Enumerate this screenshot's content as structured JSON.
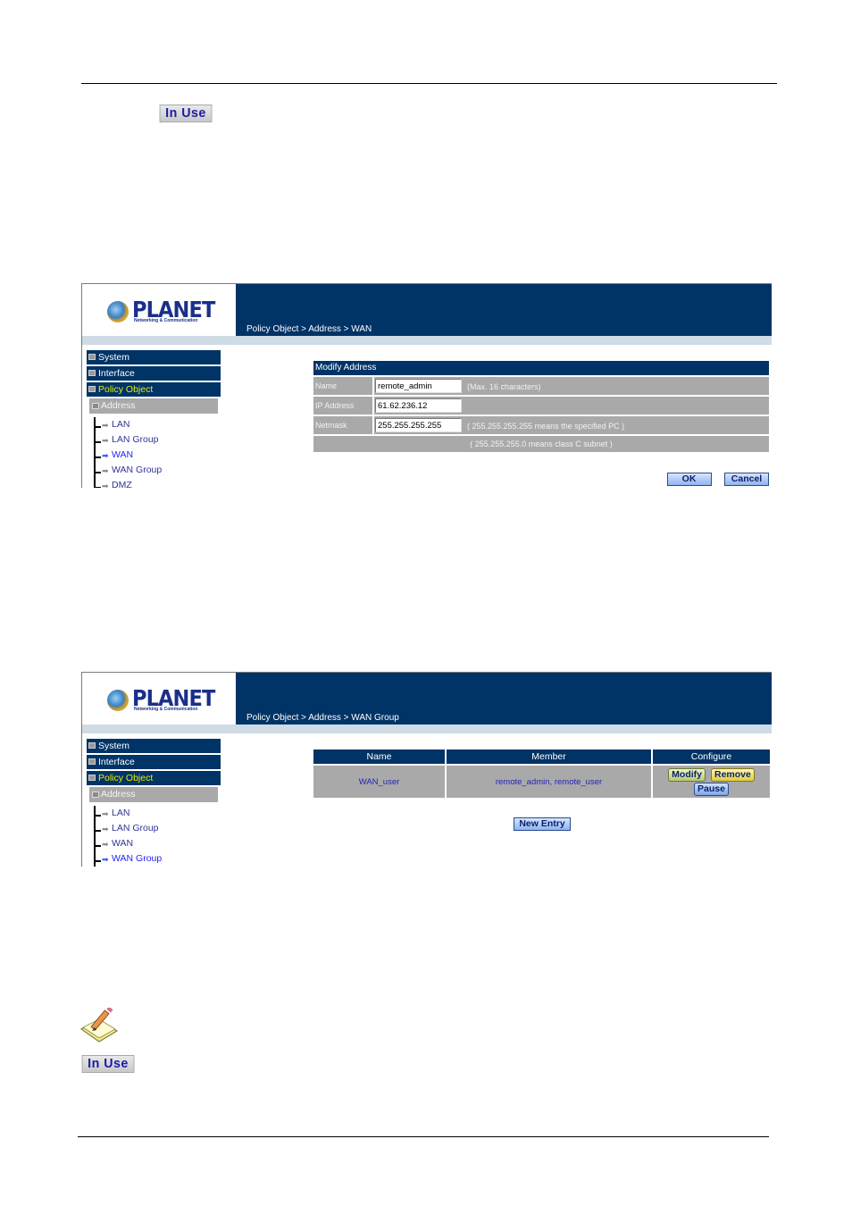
{
  "page": {
    "top_badge": "In Use",
    "bottom_badge": "In Use",
    "note_icon": "pencil-note-icon"
  },
  "shot1": {
    "logo": {
      "name": "PLANET",
      "tagline": "Networking & Communication"
    },
    "breadcrumb": "Policy Object > Address > WAN",
    "sidebar": {
      "sections": [
        {
          "label": "System",
          "active": false
        },
        {
          "label": "Interface",
          "active": false
        },
        {
          "label": "Policy Object",
          "active": true
        }
      ],
      "subsection": "Address",
      "items": [
        {
          "label": "LAN",
          "current": false
        },
        {
          "label": "LAN Group",
          "current": false
        },
        {
          "label": "WAN",
          "current": true
        },
        {
          "label": "WAN Group",
          "current": false
        },
        {
          "label": "DMZ",
          "current": false
        }
      ]
    },
    "form": {
      "title": "Modify Address",
      "fields": [
        {
          "label": "Name",
          "value": "remote_admin",
          "hint": "(Max. 16 characters)"
        },
        {
          "label": "IP Address",
          "value": "61.62.236.12",
          "hint": ""
        },
        {
          "label": "Netmask",
          "value": "255.255.255.255",
          "hint": "( 255.255.255.255 means the specified PC )"
        }
      ],
      "footer_hint": "( 255.255.255.0 means class C subnet )",
      "ok_label": "OK",
      "cancel_label": "Cancel"
    }
  },
  "shot2": {
    "logo": {
      "name": "PLANET",
      "tagline": "Networking & Communication"
    },
    "breadcrumb": "Policy Object > Address > WAN Group",
    "sidebar": {
      "sections": [
        {
          "label": "System",
          "active": false
        },
        {
          "label": "Interface",
          "active": false
        },
        {
          "label": "Policy Object",
          "active": true
        }
      ],
      "subsection": "Address",
      "items": [
        {
          "label": "LAN",
          "current": false
        },
        {
          "label": "LAN Group",
          "current": false
        },
        {
          "label": "WAN",
          "current": false
        },
        {
          "label": "WAN Group",
          "current": true
        }
      ]
    },
    "table": {
      "headers": [
        "Name",
        "Member",
        "Configure"
      ],
      "rows": [
        {
          "name": "WAN_user",
          "member": "remote_admin, remote_user"
        }
      ],
      "modify_label": "Modify",
      "remove_label": "Remove",
      "pause_label": "Pause"
    },
    "new_entry_label": "New Entry"
  }
}
